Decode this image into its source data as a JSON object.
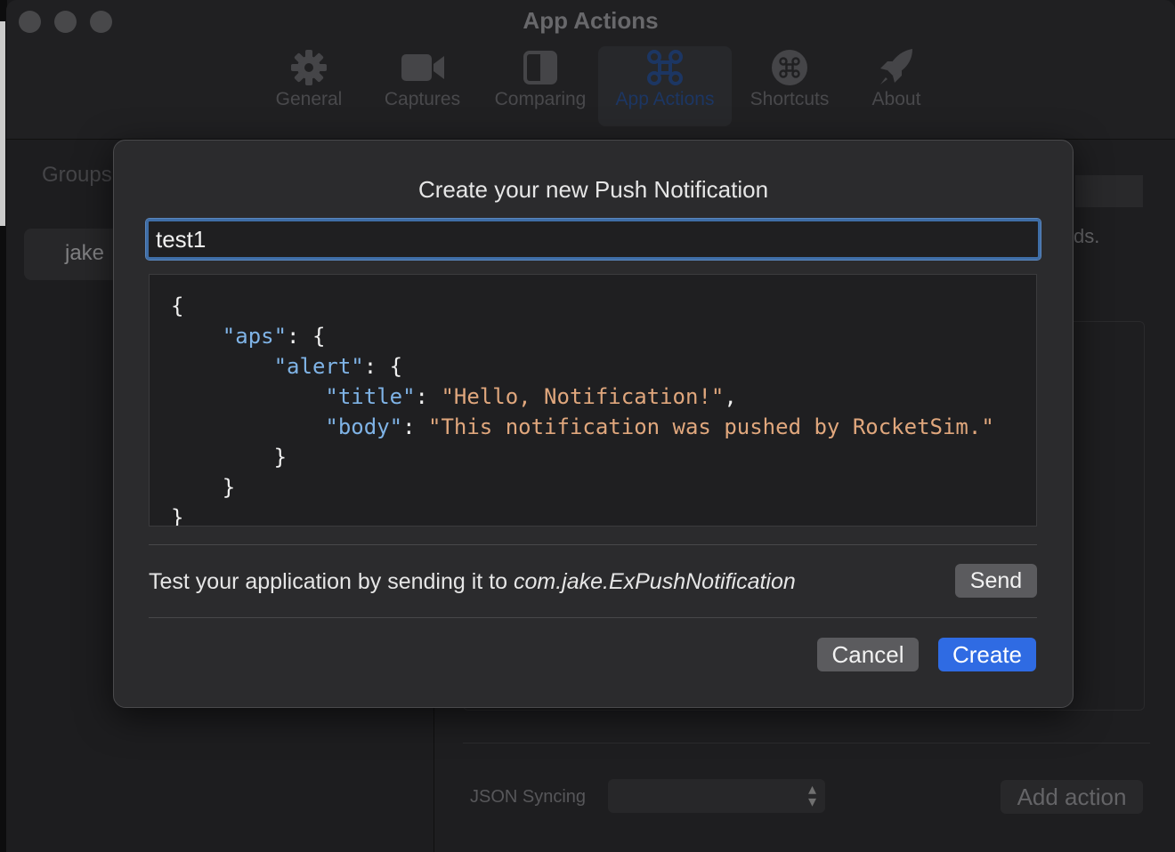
{
  "window": {
    "title": "App Actions"
  },
  "toolbar": {
    "items": [
      {
        "label": "General",
        "icon": "gear-icon"
      },
      {
        "label": "Captures",
        "icon": "video-camera-icon"
      },
      {
        "label": "Comparing",
        "icon": "split-view-icon"
      },
      {
        "label": "App Actions",
        "icon": "command-icon",
        "selected": true
      },
      {
        "label": "Shortcuts",
        "icon": "command-circle-icon"
      },
      {
        "label": "About",
        "icon": "rocket-icon"
      }
    ]
  },
  "sidebar": {
    "groups_label": "Groups",
    "selected_group": "jake"
  },
  "main": {
    "hint_fragment": "ds.",
    "json_syncing_label": "JSON Syncing",
    "add_action_label": "Add action"
  },
  "dialog": {
    "title": "Create your new Push Notification",
    "name_value": "test1",
    "payload": {
      "aps_key": "\"aps\"",
      "alert_key": "\"alert\"",
      "title_key": "\"title\"",
      "title_value": "\"Hello, Notification!\"",
      "body_key": "\"body\"",
      "body_value": "\"This notification was pushed by RocketSim.\""
    },
    "test_text": "Test your application by sending it to ",
    "bundle_id": "com.jake.ExPushNotification",
    "send_label": "Send",
    "cancel_label": "Cancel",
    "create_label": "Create"
  },
  "colors": {
    "accent": "#2f6be3",
    "json_key": "#7fb3e6",
    "json_string": "#e0a77d",
    "focus_ring": "#3f6ea7"
  }
}
